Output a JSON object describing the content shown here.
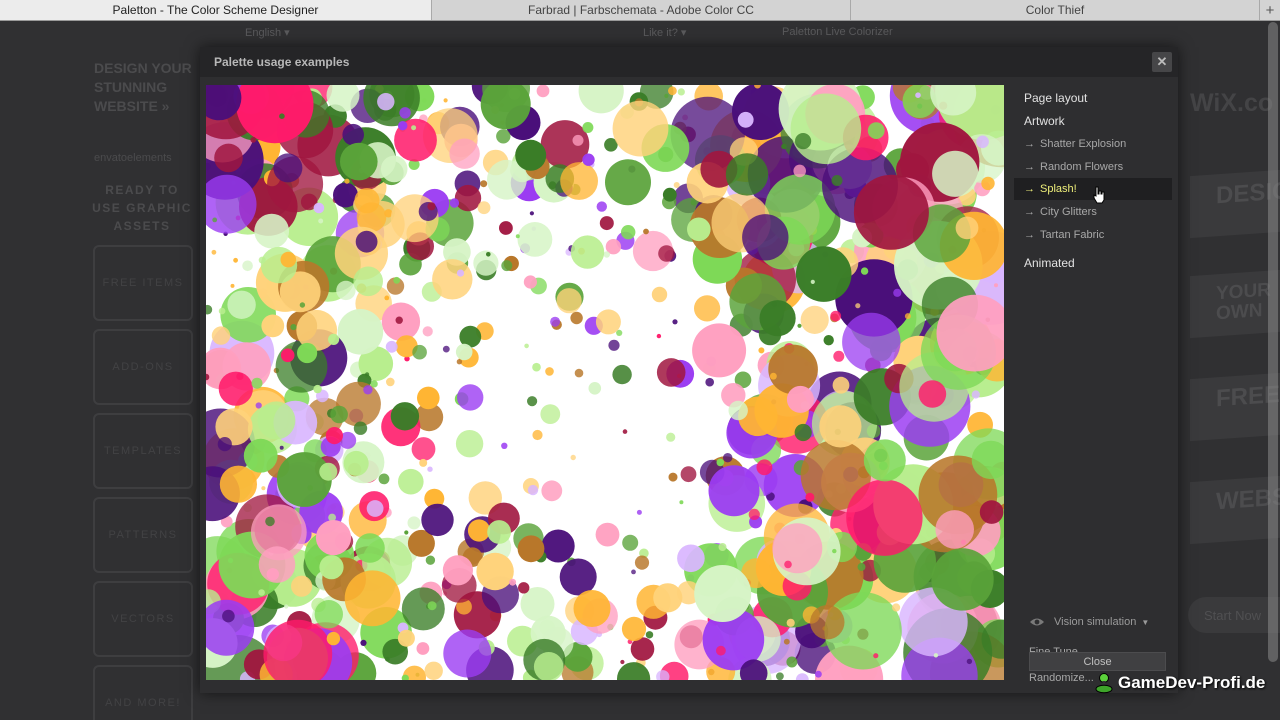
{
  "browser": {
    "tabs": [
      {
        "label": "Paletton - The Color Scheme Designer",
        "active": true
      },
      {
        "label": "Farbrad | Farbschemata - Adobe Color CC",
        "active": false
      },
      {
        "label": "Color Thief",
        "active": false
      }
    ],
    "new_tab_label": "+"
  },
  "background_page": {
    "nav": [
      "English",
      "Like it?",
      "Paletton Live Colorizer"
    ],
    "ad_title": "Design your stunning website »",
    "envato_logo": "envatoelements",
    "ready_text": "Ready to use graphic assets",
    "ad_buttons": [
      "Free items",
      "Add-ons",
      "Templates",
      "Patterns",
      "Vectors",
      "And more!"
    ],
    "wix_logo": "WiX.co",
    "right_banners": [
      "DESIG",
      "YOUR OWN",
      "FREE",
      "WEBSIT"
    ],
    "start_now": "Start Now"
  },
  "modal": {
    "title": "Palette usage examples",
    "close_icon": "close-x-icon",
    "sidebar": {
      "page_layout": "Page layout",
      "artwork": "Artwork",
      "artwork_items": [
        {
          "label": "Shatter Explosion",
          "active": false
        },
        {
          "label": "Random Flowers",
          "active": false
        },
        {
          "label": "Splash!",
          "active": true
        },
        {
          "label": "City Glitters",
          "active": false
        },
        {
          "label": "Tartan Fabric",
          "active": false
        }
      ],
      "arrow_glyph": "→",
      "animated": "Animated",
      "vision_simulation": "Vision simulation",
      "fine_tune": "Fine Tune...",
      "randomize": "Randomize...",
      "close_button": "Close"
    }
  },
  "palette_colors": [
    "#7ed957",
    "#b8ee8e",
    "#d6f4c6",
    "#5aa33a",
    "#3a7d27",
    "#ffb533",
    "#ffd27a",
    "#ff1a6a",
    "#ff9fc0",
    "#9b3cf2",
    "#d9b6ff",
    "#4a0f7a",
    "#a0163f",
    "#b8772a"
  ],
  "watermark": "GameDev-Profi.de"
}
